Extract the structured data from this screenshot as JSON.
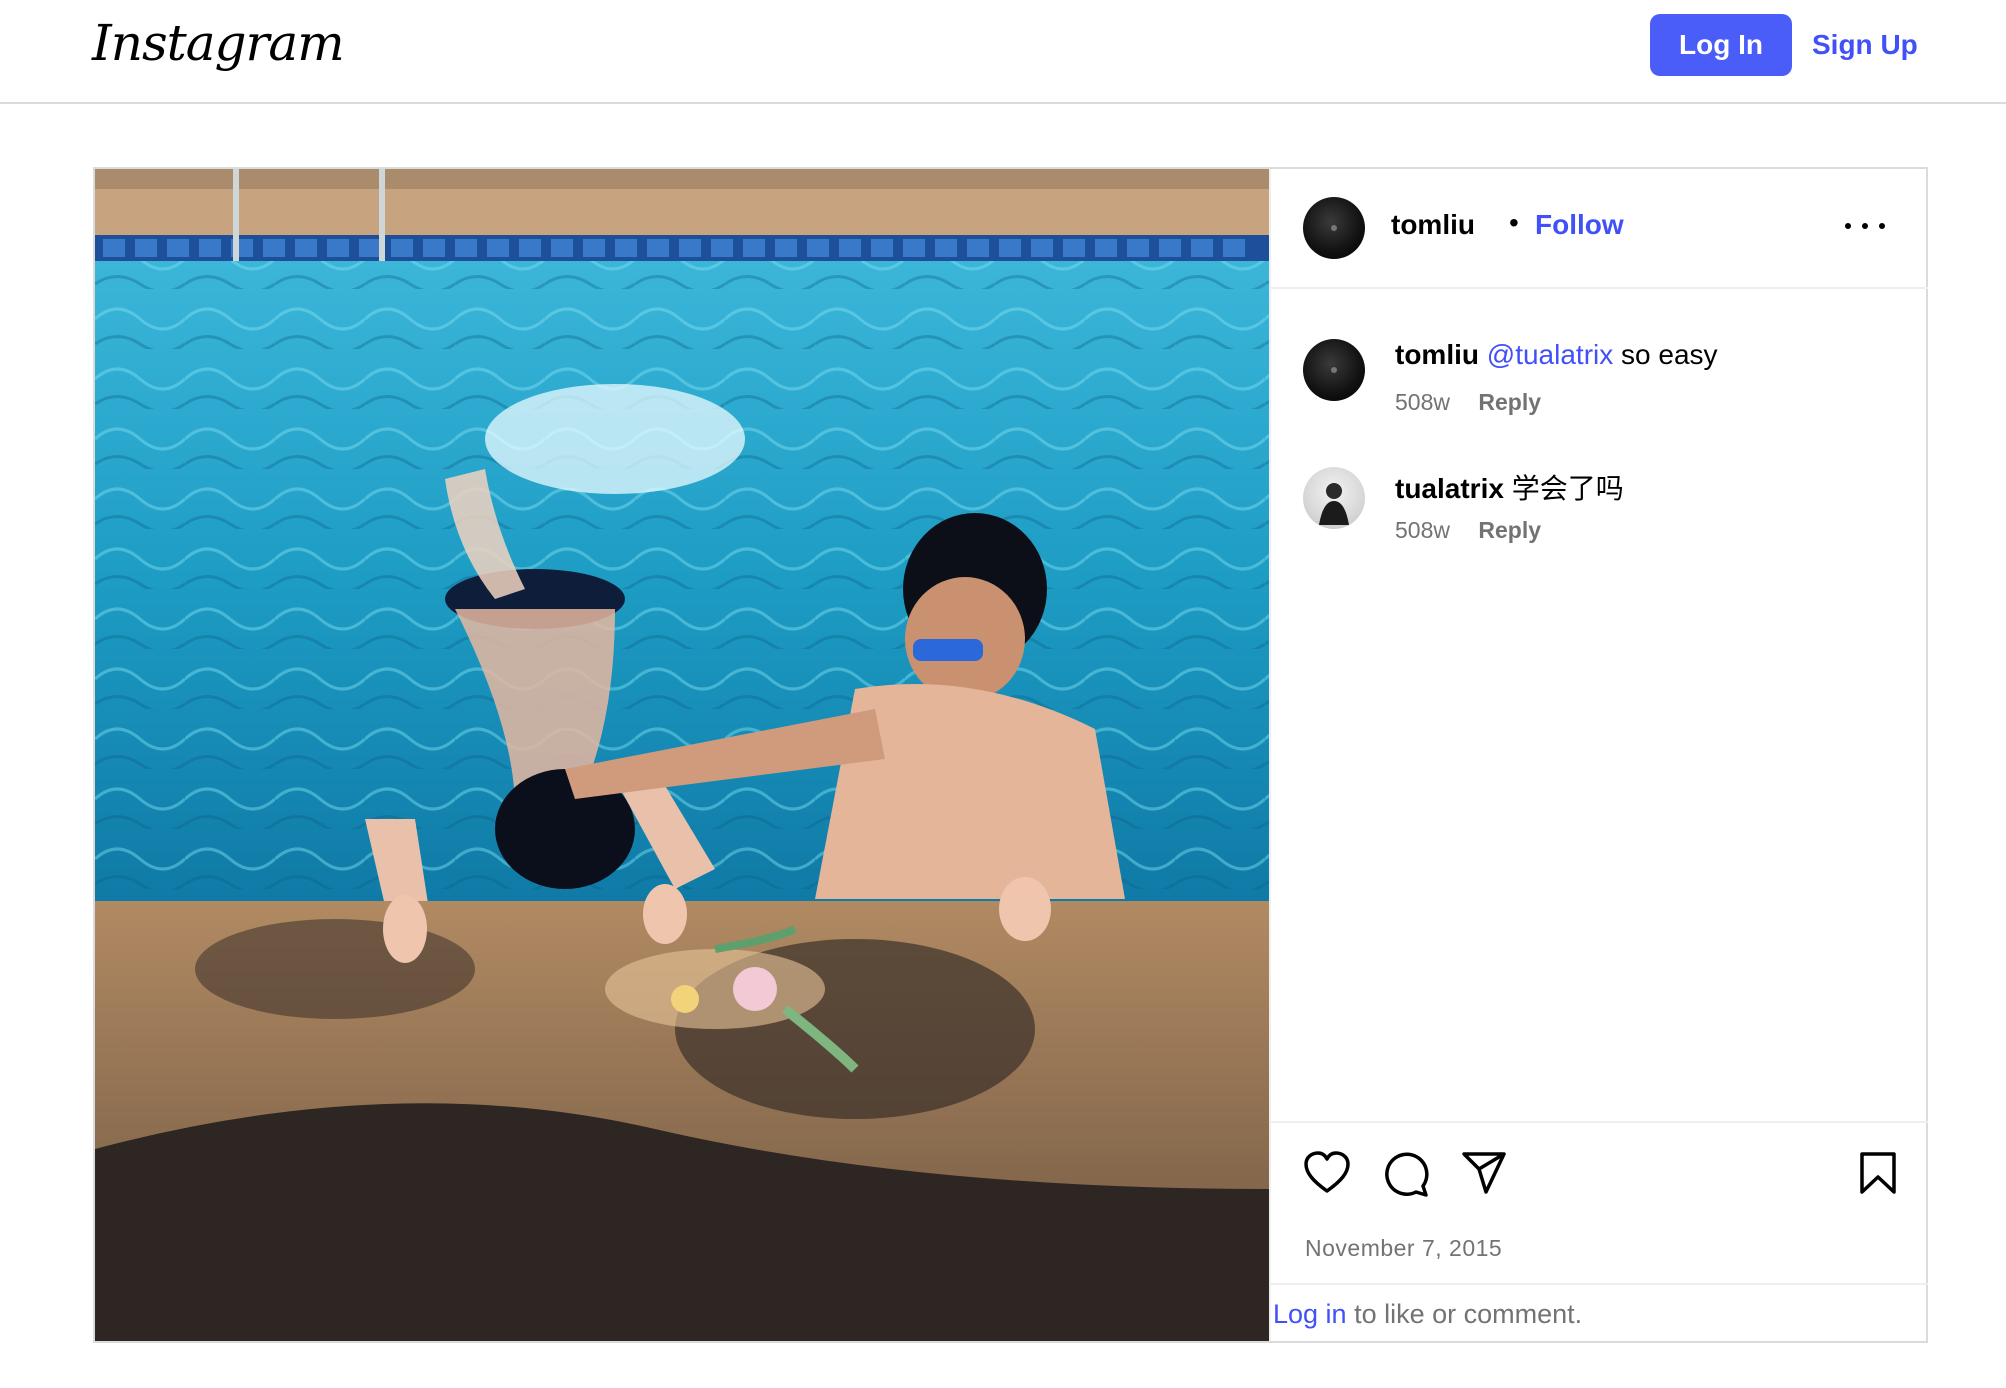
{
  "header": {
    "logo_text": "Instagram",
    "login_label": "Log In",
    "signup_label": "Sign Up"
  },
  "post": {
    "author": "tomliu",
    "separator": "•",
    "follow_label": "Follow",
    "comments": [
      {
        "user": "tomliu",
        "mention": "@tualatrix",
        "text": " so easy",
        "age": "508w",
        "reply_label": "Reply"
      },
      {
        "user": "tualatrix",
        "mention": "",
        "text": " 学会了吗",
        "age": "508w",
        "reply_label": "Reply"
      }
    ],
    "date": "November 7, 2015",
    "login_link": "Log in",
    "login_suffix": " to like or comment."
  },
  "colors": {
    "accent": "#4a5df9",
    "link": "#4150f7",
    "muted": "#737373",
    "border": "#dbdbdb"
  },
  "icons": [
    "more-options-icon",
    "heart-icon",
    "comment-icon",
    "share-icon",
    "bookmark-icon"
  ]
}
